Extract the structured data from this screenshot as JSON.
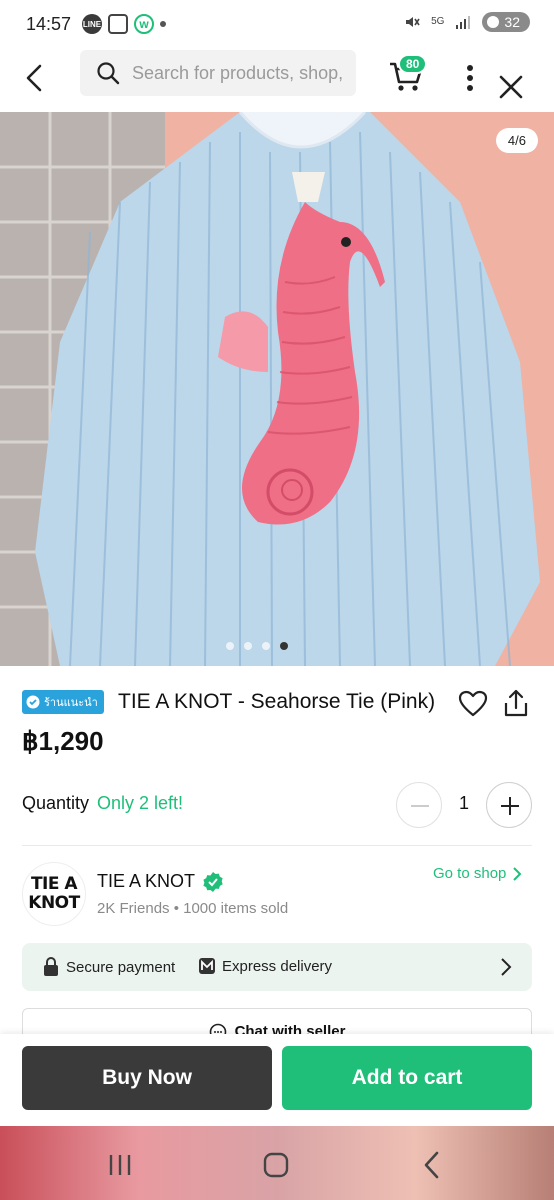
{
  "status_bar": {
    "time": "14:57",
    "battery": "32",
    "network": "5G"
  },
  "search": {
    "placeholder": "Search for products, shop,"
  },
  "header": {
    "cart_count": "80"
  },
  "product": {
    "image_counter": "4/6",
    "badge": "ร้านแนะนำ",
    "title": "TIE A KNOT - Seahorse Tie (Pink)",
    "price": "฿1,290"
  },
  "quantity": {
    "label": "Quantity",
    "stock_note": "Only 2 left!",
    "value": "1"
  },
  "shop": {
    "logo_line1": "TIE A",
    "logo_line2": "KNOT",
    "name": "TIE A KNOT",
    "stats": "2K Friends • 1000 items sold",
    "go_to_shop": "Go to shop"
  },
  "payment": {
    "secure": "Secure payment",
    "express": "Express delivery"
  },
  "chat": {
    "label": "Chat with seller"
  },
  "actions": {
    "buy_now": "Buy Now",
    "add_to_cart": "Add to cart"
  },
  "colors": {
    "accent": "#1fbf7a",
    "badge_blue": "#2aa3dd",
    "dark_button": "#3a3a3a"
  },
  "icons": [
    "back-arrow-icon",
    "search-icon",
    "cart-icon",
    "more-vertical-icon",
    "close-icon",
    "heart-icon",
    "share-icon",
    "verified-icon",
    "lock-icon",
    "express-icon",
    "chat-icon",
    "minus-icon",
    "plus-icon"
  ]
}
